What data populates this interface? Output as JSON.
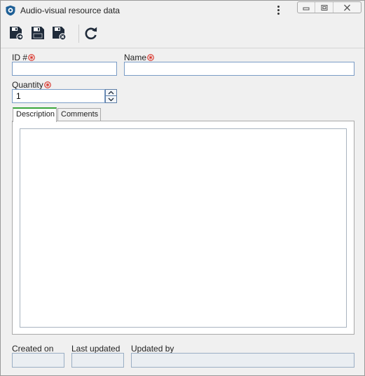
{
  "window": {
    "title": "Audio-visual resource data",
    "icon": "app-shield-icon",
    "menu_icon": "kebab-menu-icon",
    "controls": [
      "minimize-icon",
      "restore-icon",
      "close-icon"
    ]
  },
  "toolbar": {
    "buttons": [
      {
        "name": "save-and-new-button",
        "icon": "save-new-icon"
      },
      {
        "name": "save-button",
        "icon": "save-icon"
      },
      {
        "name": "save-and-close-button",
        "icon": "save-close-icon"
      },
      {
        "name": "refresh-button",
        "icon": "refresh-icon"
      }
    ]
  },
  "form": {
    "id_label": "ID #",
    "id_value": "",
    "name_label": "Name",
    "name_value": "",
    "quantity_label": "Quantity",
    "quantity_value": "1",
    "required_icon": "required-asterisk-icon",
    "required_color": "#d9342b"
  },
  "tabs": [
    {
      "label": "Description",
      "active": true
    },
    {
      "label": "Comments",
      "active": false
    }
  ],
  "description_value": "",
  "footer": {
    "created_on_label": "Created on",
    "created_on_value": "",
    "last_updated_label": "Last updated",
    "last_updated_value": "",
    "updated_by_label": "Updated by",
    "updated_by_value": ""
  },
  "colors": {
    "accent_tab": "#3aa53a",
    "field_border": "#7a9cc6",
    "icon_dark": "#1f2b3a"
  }
}
